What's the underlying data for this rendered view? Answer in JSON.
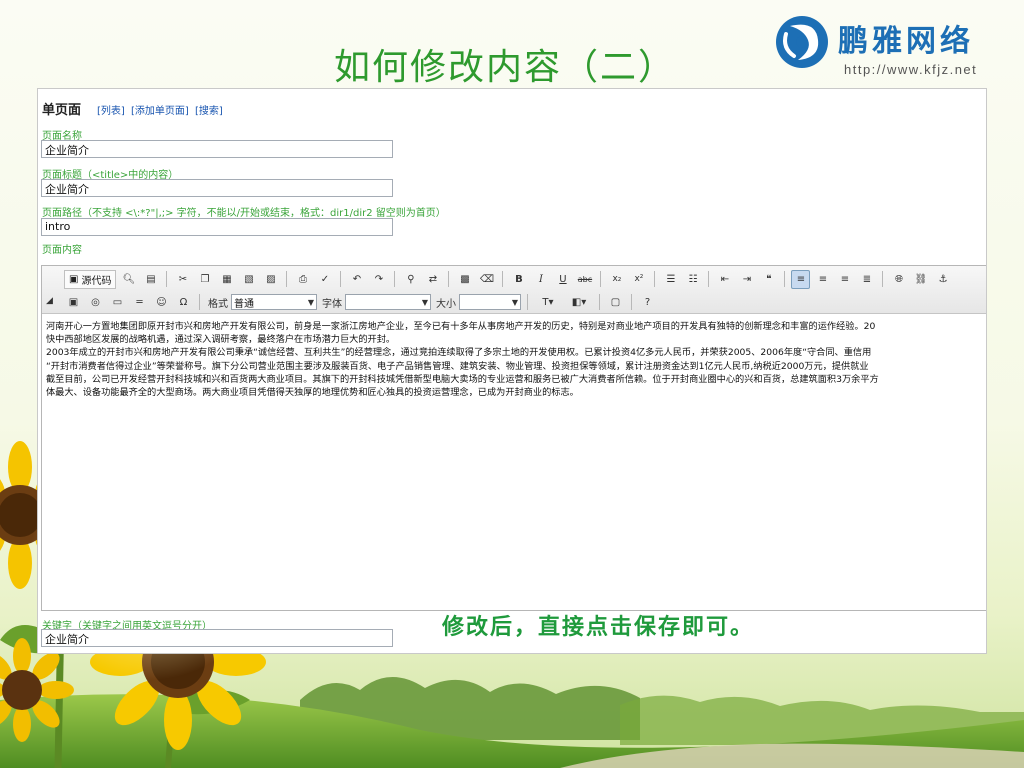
{
  "slide": {
    "title": "如何修改内容（二）",
    "logo_text": "鹏雅网络",
    "logo_url": "http://www.kfjz.net",
    "accent_color": "#2e9a2e",
    "logo_color": "#1d6fb5"
  },
  "cms": {
    "heading": "单页面",
    "links": [
      "[列表]",
      "[添加单页面]",
      "[搜索]"
    ],
    "fields": {
      "page_name": {
        "label": "页面名称",
        "value": "企业简介"
      },
      "page_title": {
        "label": "页面标题（<title>中的内容）",
        "value": "企业简介"
      },
      "page_path": {
        "label": "页面路径（不支持 <\\:*?\"|,;> 字符，不能以/开始或结束，格式：dir1/dir2 留空则为首页）",
        "value": "intro"
      },
      "page_content": {
        "label": "页面内容"
      },
      "keywords": {
        "label": "关键字（关键字之间用英文逗号分开）",
        "value": "企业简介"
      }
    },
    "toolbar": {
      "source_label": "源代码",
      "format_label": "格式",
      "format_value": "普通",
      "font_label": "字体",
      "size_label": "大小"
    },
    "content_lines": [
      "河南开心一方置地集团即原开封市兴和房地产开发有限公司，前身是一家浙江房地产企业，至今已有十多年从事房地产开发的历史，特别是对商业地产项目的开发具有独特的创新理念和丰富的运作经验。20",
      "快中西部地区发展的战略机遇，通过深入调研考察，最终落户在市场潜力巨大的开封。",
      "2003年成立的开封市兴和房地产开发有限公司秉承“诚信经营、互利共生”的经营理念，通过竞拍连续取得了多宗土地的开发使用权。已累计投资4亿多元人民币，并荣获2005、2006年度“守合同、重信用",
      "“开封市消费者信得过企业”等荣誉称号。旗下分公司营业范围主要涉及服装百货、电子产品销售管理、建筑安装、物业管理、投资担保等领域，累计注册资金达到1亿元人民币,纳税近2000万元，提供就业",
      "截至目前，公司已开发经营开封科技城和兴和百货两大商业项目。其旗下的开封科技城凭借新型电脑大卖场的专业运营和服务已被广大消费者所信赖。位于开封商业圈中心的兴和百货，总建筑面积3万余平方",
      "体最大、设备功能最齐全的大型商场。两大商业项目凭借得天独厚的地理优势和匠心独具的投资运营理念，已成为开封商业的标志。"
    ],
    "save_hint": "修改后，直接点击保存即可。"
  }
}
